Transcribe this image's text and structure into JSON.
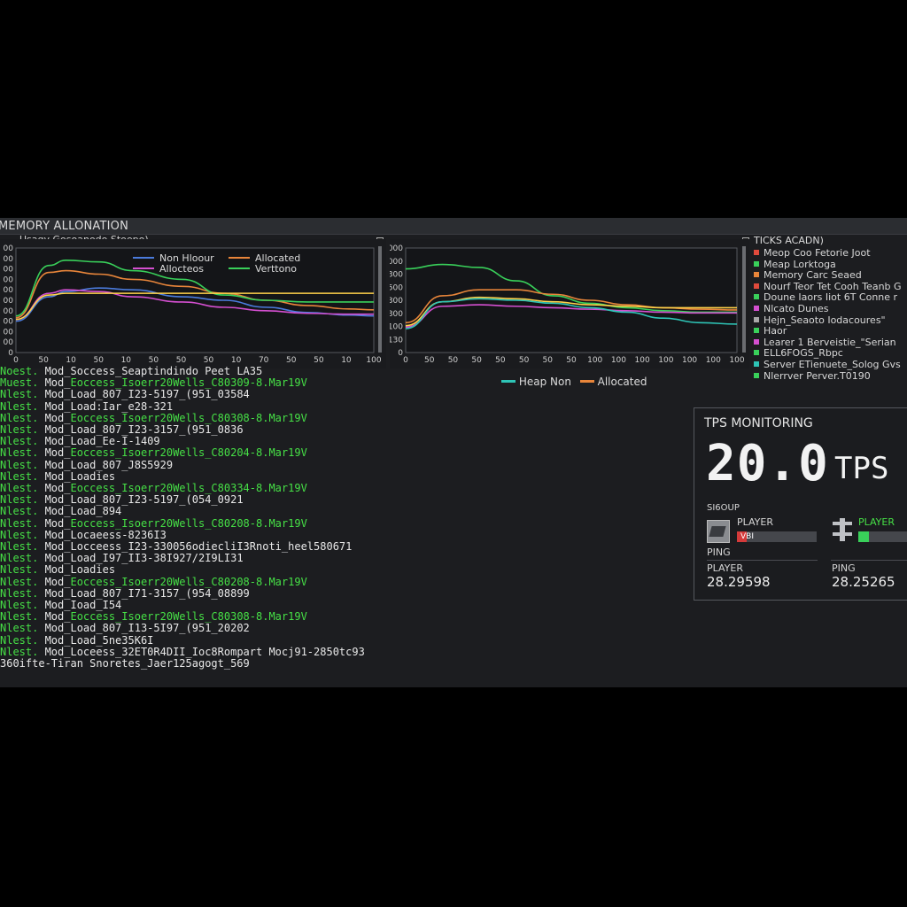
{
  "window": {
    "title": "MEMORY ALLONATION",
    "subtitle": "Usagy Gosoanodo Stoepo)"
  },
  "left_chart": {
    "y_ticks": [
      "00",
      "00",
      "00",
      "00",
      "00",
      "00",
      "00",
      "00",
      "00",
      "00",
      "0"
    ],
    "x_ticks": [
      "0",
      "50",
      "10",
      "50",
      "10",
      "50",
      "50",
      "50",
      "10",
      "70",
      "50",
      "50",
      "10",
      "100"
    ],
    "legend": [
      "Non Hloour",
      "Allocated",
      "Allocteos",
      "Verttono"
    ],
    "colors": [
      "#4b7bdc",
      "#e8853a",
      "#d44fd0",
      "#39d05a",
      "#ffd24a"
    ]
  },
  "right_chart": {
    "y_ticks": [
      "1000",
      "1000",
      "300",
      "500",
      "300",
      "300",
      "100",
      "130",
      "0"
    ],
    "x_ticks": [
      "0",
      "50",
      "50",
      "50",
      "50",
      "50",
      "50",
      "50",
      "100",
      "100",
      "100",
      "100",
      "100",
      "100",
      "100"
    ],
    "legend": [
      "Heap Non",
      "Allocated"
    ],
    "legend_colors": [
      "#2ec4b6",
      "#e8853a"
    ],
    "colors": [
      "#39d05a",
      "#e8853a",
      "#ffd24a",
      "#d44fd0",
      "#2ec4b6"
    ]
  },
  "chart_data": [
    {
      "type": "line",
      "x": [
        0,
        40,
        60,
        100,
        140,
        200,
        250,
        300,
        350,
        400,
        430
      ],
      "series": [
        {
          "name": "Non Hloour",
          "values": [
            180,
            320,
            350,
            370,
            360,
            320,
            300,
            260,
            230,
            215,
            210
          ]
        },
        {
          "name": "Allocated",
          "values": [
            200,
            460,
            470,
            450,
            420,
            380,
            340,
            300,
            270,
            250,
            245
          ]
        },
        {
          "name": "Allocteos",
          "values": [
            190,
            340,
            360,
            350,
            320,
            290,
            260,
            240,
            225,
            220,
            220
          ]
        },
        {
          "name": "Verttono",
          "values": [
            210,
            500,
            530,
            520,
            470,
            420,
            330,
            300,
            290,
            290,
            290
          ]
        },
        {
          "values": [
            190,
            330,
            340,
            340,
            340,
            340,
            340,
            340,
            340,
            340,
            340
          ]
        }
      ],
      "xlim": [
        0,
        430
      ],
      "ylim": [
        0,
        600
      ],
      "grid": false
    },
    {
      "type": "line",
      "x": [
        0,
        40,
        80,
        120,
        160,
        200,
        240,
        280,
        320,
        360
      ],
      "series": [
        {
          "values": [
            560,
            590,
            570,
            480,
            380,
            330,
            300,
            280,
            270,
            270
          ]
        },
        {
          "name": "Allocated",
          "values": [
            200,
            380,
            420,
            420,
            390,
            350,
            320,
            300,
            290,
            285
          ]
        },
        {
          "values": [
            180,
            340,
            370,
            360,
            340,
            320,
            310,
            300,
            300,
            300
          ]
        },
        {
          "values": [
            170,
            310,
            320,
            310,
            300,
            290,
            280,
            270,
            265,
            265
          ]
        },
        {
          "name": "Heap Non",
          "values": [
            160,
            340,
            360,
            350,
            330,
            300,
            270,
            230,
            200,
            190
          ]
        }
      ],
      "xlim": [
        0,
        360
      ],
      "ylim": [
        0,
        700
      ],
      "grid": false
    }
  ],
  "ticks": {
    "title": "TICKS ACADN)",
    "items": [
      {
        "label": "Meop Coo Fetorie Joot",
        "color": "#e04a3c"
      },
      {
        "label": "Meap Lorktoga",
        "color": "#39d05a"
      },
      {
        "label": "Memory Carc Seaed",
        "color": "#e8853a"
      },
      {
        "label": "Nourf Teor Tet Cooh Teanb G",
        "color": "#e04a3c"
      },
      {
        "label": "Doune Iaors Iiot 6T Conne r",
        "color": "#39d05a"
      },
      {
        "label": "Nlcato Dunes",
        "color": "#d44fd0"
      },
      {
        "label": "Hejn_Seaoto Iodacoures\"",
        "color": "#a8a8a8"
      },
      {
        "label": "Haor",
        "color": "#39d05a"
      },
      {
        "label": "Learer 1 Berveistie_\"Serian",
        "color": "#d44fd0"
      },
      {
        "label": "ELL6FOGS_Rbpc",
        "color": "#39d05a"
      },
      {
        "label": "Server ETienuete_Solog Gvs",
        "color": "#2ec4b6"
      },
      {
        "label": "Nlerrver Perver.T0190",
        "color": "#39d05a"
      }
    ]
  },
  "log": [
    {
      "pre": "Noest.",
      "mid": " Mod_Soccess_Seaptindindo Peet LA35",
      "hl": ""
    },
    {
      "pre": "Muest.",
      "mid": " Mod_",
      "hl": "Eoccess_Isoerr20Wells_C80309-8.Mar19V"
    },
    {
      "pre": "Nlest.",
      "mid": " Mod_Load_807_I23-5197_(951_03584",
      "hl": ""
    },
    {
      "pre": "Nlest.",
      "mid": " Mod_Load:Iar_e28-321",
      "hl": ""
    },
    {
      "pre": "Nlest.",
      "mid": " Mod_",
      "hl": "Eoccess_Isoerr20Wells_C80308-8.Mar19V"
    },
    {
      "pre": "Nlest.",
      "mid": " Mod_Load_807_I23-3157_(951_0836",
      "hl": ""
    },
    {
      "pre": "Nlest.",
      "mid": " Mod_Load_Ee-I-1409",
      "hl": ""
    },
    {
      "pre": "Nlest.",
      "mid": " Mod_",
      "hl": "Eoccess_Isoerr20Wells_C80204-8.Mar19V"
    },
    {
      "pre": "Nlest.",
      "mid": " Mod_Load_807_J8S5929",
      "hl": ""
    },
    {
      "pre": "Nlest.",
      "mid": " Mod_Loadies",
      "hl": ""
    },
    {
      "pre": "Nlest.",
      "mid": " Mod_",
      "hl": "Eoccess_Isoerr20Wells_C80334-8.Mar19V"
    },
    {
      "pre": "Nlest.",
      "mid": " Mod_Load_807_I23-5197_(054_0921",
      "hl": ""
    },
    {
      "pre": "Nlest.",
      "mid": " Mod_Load_894",
      "hl": ""
    },
    {
      "pre": "Nlest.",
      "mid": " Mod_",
      "hl": "Eoccess_Isoerr20Wells_C80208-8.Mar19V"
    },
    {
      "pre": "Nlest.",
      "mid": " Mod_Locaeess-8236I3",
      "hl": ""
    },
    {
      "pre": "Nlest.",
      "mid": " Mod_Locceess_I23-330056odiecliI3Rnoti_heel580671",
      "hl": ""
    },
    {
      "pre": "Nlest.",
      "mid": " Mod_Load_I97_II3-38I927/2I9LI31",
      "hl": ""
    },
    {
      "pre": "Nlest.",
      "mid": " Mod_Loadies",
      "hl": ""
    },
    {
      "pre": "Nlest.",
      "mid": " Mod_",
      "hl": "Eoccess_Isoerr20Wells_C80208-8.Mar19V"
    },
    {
      "pre": "Nlest.",
      "mid": " Mod_Load_807_I71-3157_(954_08899",
      "hl": ""
    },
    {
      "pre": "Nlest.",
      "mid": " Mod_Ioad_I54",
      "hl": ""
    },
    {
      "pre": "Nlest.",
      "mid": " Mod_",
      "hl": "Eoccess_Isoerr20Wells_C80308-8.Mar19V"
    },
    {
      "pre": "Nlest.",
      "mid": " Mod_Load_807_I13-5I97_(951_20202",
      "hl": ""
    },
    {
      "pre": "Nlest.",
      "mid": " Mod_Load_5ne35K6I",
      "hl": ""
    },
    {
      "pre": "Nlest.",
      "mid": " Mod_Loceess_32ET0R4DII_Ioc8Rompart Mocj91-2850tc93",
      "hl": ""
    },
    {
      "pre": "",
      "mid": "360ifte-Tiran Snoretes_Jaer125agogt_569",
      "hl": ""
    }
  ],
  "tps": {
    "title": "TPS MONITORING",
    "value": "20.0",
    "unit": "TPS",
    "status_label": "SI6OUP",
    "player_label_1": "PLAYER",
    "player_label_2": "PLAYER",
    "badge": "VBI",
    "ping_label_1": "PING",
    "ping_label_2": "PING",
    "player_label_3": "PLAYER",
    "value_left": "28.29598",
    "value_right": "28.25265",
    "bar_left_fraction": 0.12,
    "bar_right_fraction": 0.2,
    "bar_left_color": "#d43a3a",
    "bar_right_color": "#39d05a"
  }
}
